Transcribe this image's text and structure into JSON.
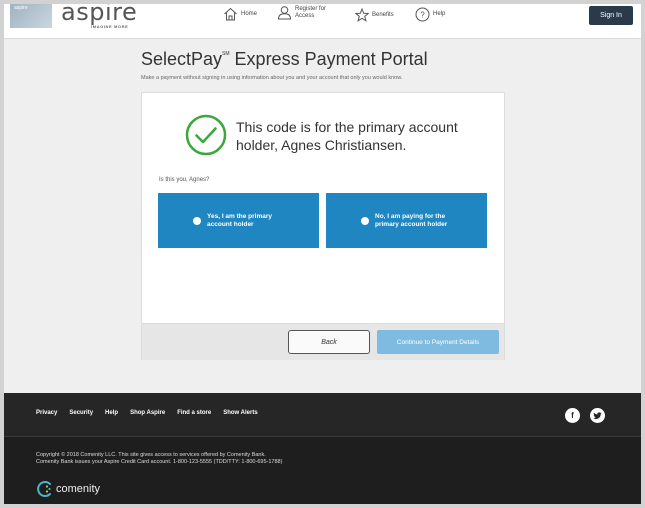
{
  "header": {
    "card_text": "aspire",
    "logo_text": "aspire",
    "logo_tagline": "IMAGINE MORE",
    "nav": {
      "home": "Home",
      "register": "Register for Access",
      "benefits": "Benefits",
      "help": "Help"
    },
    "signin_label": "Sign In"
  },
  "page": {
    "title": "SelectPay",
    "title_mark": "SM",
    "title_rest": " Express Payment Portal",
    "subtitle": "Make a payment without signing in using information about you and your account that only you would know."
  },
  "panel": {
    "message": "This code is for the primary account holder, Agnes Christiansen.",
    "question": "Is this you, Agnes?",
    "choices": [
      {
        "label": "Yes, I am the primary account holder"
      },
      {
        "label": "No, I am paying for the primary account holder"
      }
    ],
    "back_label": "Back",
    "continue_label": "Continue to Payment Details"
  },
  "footer": {
    "links": [
      "Privacy",
      "Security",
      "Help",
      "Shop Aspire",
      "Find a store",
      "Show Alerts"
    ],
    "social": {
      "facebook": "f",
      "twitter": "t"
    },
    "copyright_line1": "Copyright © 2018 Comenity LLC. This site gives access to services offered by Comenity Bank.",
    "copyright_line2": "Comenity Bank issues your Aspire Credit Card account. 1-800-123-5555 (TDD/TTY: 1-800-695-1788)",
    "brand": "comenity"
  },
  "colors": {
    "accent_blue": "#1f86c1",
    "disabled_blue": "#7fbbe0",
    "success_green": "#3aa83a",
    "footer_dark": "#262626",
    "signin_dark": "#2b3a4a"
  },
  "icons": [
    "home-icon",
    "user-icon",
    "star-icon",
    "help-icon",
    "check-circle-icon",
    "facebook-icon",
    "twitter-icon",
    "comenity-logo-icon"
  ]
}
